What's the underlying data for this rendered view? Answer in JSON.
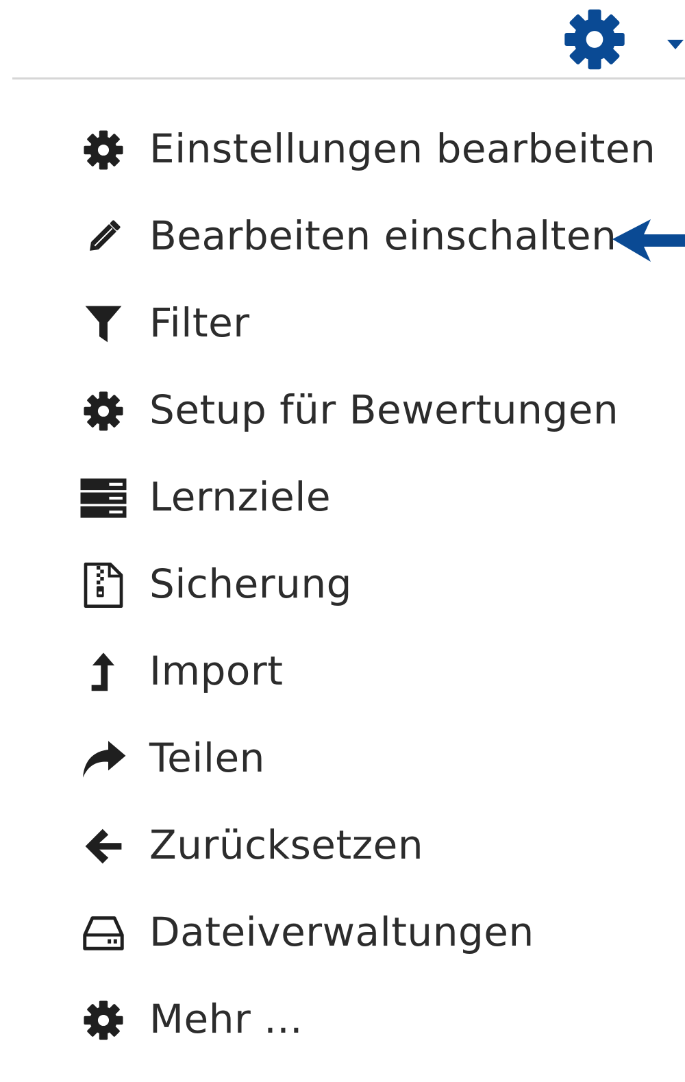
{
  "colors": {
    "accent": "#0a4a94",
    "text": "#2c2c2c",
    "icon": "#1f1f1f",
    "divider": "#d6d6d6"
  },
  "header": {
    "settings_icon": "gear-icon",
    "dropdown_icon": "caret-down-icon"
  },
  "menu": {
    "items": [
      {
        "label": "Einstellungen bearbeiten",
        "icon": "gear-icon"
      },
      {
        "label": "Bearbeiten einschalten",
        "icon": "pencil-icon"
      },
      {
        "label": "Filter",
        "icon": "filter-icon"
      },
      {
        "label": "Setup für Bewertungen",
        "icon": "gear-icon"
      },
      {
        "label": "Lernziele",
        "icon": "server-icon"
      },
      {
        "label": "Sicherung",
        "icon": "file-archive-icon"
      },
      {
        "label": "Import",
        "icon": "level-up-icon"
      },
      {
        "label": "Teilen",
        "icon": "share-icon"
      },
      {
        "label": "Zurücksetzen",
        "icon": "arrow-left-icon"
      },
      {
        "label": "Dateiverwaltungen",
        "icon": "hdd-icon"
      },
      {
        "label": "Mehr ...",
        "icon": "gear-icon"
      }
    ]
  },
  "annotation": {
    "icon": "arrow-left-icon",
    "color": "#0a4a94"
  }
}
